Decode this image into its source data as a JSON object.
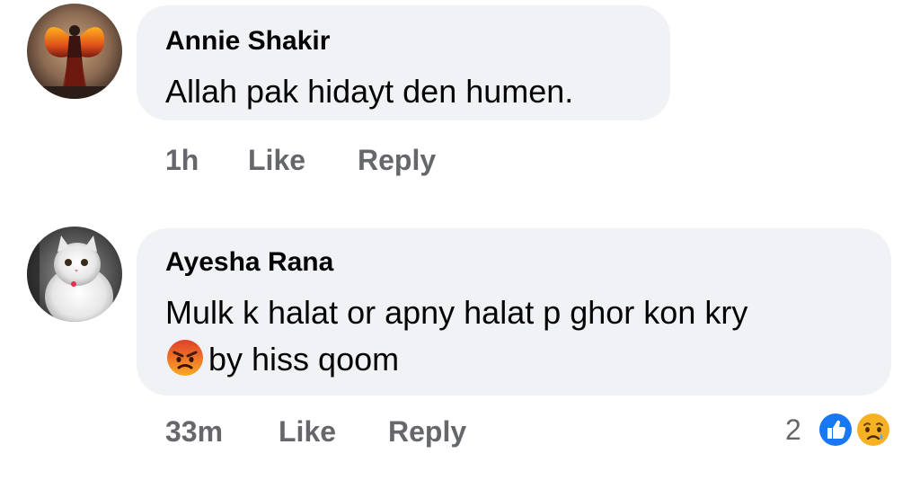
{
  "comments": [
    {
      "author": "Annie Shakir",
      "text_lines": [
        "Allah pak hidayt den humen."
      ],
      "time": "1h",
      "like_label": "Like",
      "reply_label": "Reply",
      "avatar_icon": "avatar-fire-wings-figure"
    },
    {
      "author": "Ayesha Rana",
      "text_lines": [
        "Mulk k halat or apny halat p ghor kon kry",
        "by hiss qoom"
      ],
      "inline_emoji": "angry-face-emoji",
      "time": "33m",
      "like_label": "Like",
      "reply_label": "Reply",
      "avatar_icon": "avatar-white-kitten",
      "reactions": {
        "count": "2",
        "icons": [
          "like-reaction-icon",
          "sad-reaction-icon"
        ],
        "like_color": "#1877f2",
        "sad_color": "#f7b125"
      }
    }
  ],
  "colors": {
    "bubble_bg": "#f0f2f5",
    "text": "#050505",
    "meta": "#65676b"
  }
}
